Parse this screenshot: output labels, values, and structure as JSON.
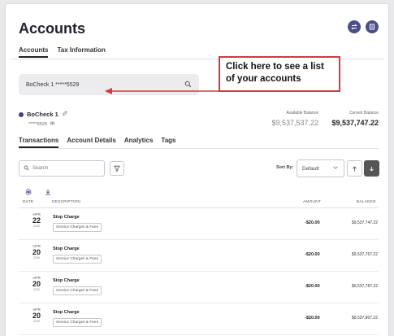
{
  "header": {
    "title": "Accounts"
  },
  "top_tabs": [
    {
      "label": "Accounts",
      "active": true
    },
    {
      "label": "Tax Information",
      "active": false
    }
  ],
  "account_picker": {
    "value": "BoCheck 1 *****5529"
  },
  "callout": {
    "line1": "Click here to see a list",
    "line2": "of your accounts"
  },
  "account": {
    "name": "BoCheck 1",
    "number": "*****5529",
    "available_label": "Available Balance",
    "available_value": "$9,537,537.22",
    "current_label": "Current Balance",
    "current_value": "$9,537,747.22"
  },
  "sub_tabs": [
    {
      "label": "Transactions",
      "active": true
    },
    {
      "label": "Account Details",
      "active": false
    },
    {
      "label": "Analytics",
      "active": false
    },
    {
      "label": "Tags",
      "active": false
    }
  ],
  "search": {
    "placeholder": "Search"
  },
  "sort": {
    "label": "Sort By:",
    "value": "Default"
  },
  "table": {
    "headers": {
      "date": "DATE",
      "description": "DESCRIPTION",
      "amount": "AMOUNT",
      "balance": "BALANCE"
    },
    "rows": [
      {
        "month": "APR",
        "day": "22",
        "year": "2026",
        "title": "Stop Charge",
        "tag": "Service Charges & Fees",
        "amount": "-$20.00",
        "balance": "$9,537,747.22"
      },
      {
        "month": "APR",
        "day": "20",
        "year": "2026",
        "title": "Stop Charge",
        "tag": "Service Charges & Fees",
        "amount": "-$20.00",
        "balance": "$9,537,767.22"
      },
      {
        "month": "APR",
        "day": "20",
        "year": "2026",
        "title": "Stop Charge",
        "tag": "Service Charges & Fees",
        "amount": "-$20.00",
        "balance": "$9,537,787.22"
      },
      {
        "month": "APR",
        "day": "20",
        "year": "2026",
        "title": "Stop Charge",
        "tag": "Service Charges & Fees",
        "amount": "-$20.00",
        "balance": "$9,537,807.22"
      }
    ]
  },
  "icons": {
    "header": [
      "transfer-icon",
      "statements-icon"
    ],
    "picker": "search-icon",
    "edit": "pencil-icon",
    "visibility": "eye-icon",
    "filter": "filter-icon",
    "tools": [
      "print-icon",
      "download-icon"
    ]
  },
  "colors": {
    "accent": "#4b4f86",
    "callout_border": "#d23b3b",
    "arrow": "#d23b3b"
  }
}
